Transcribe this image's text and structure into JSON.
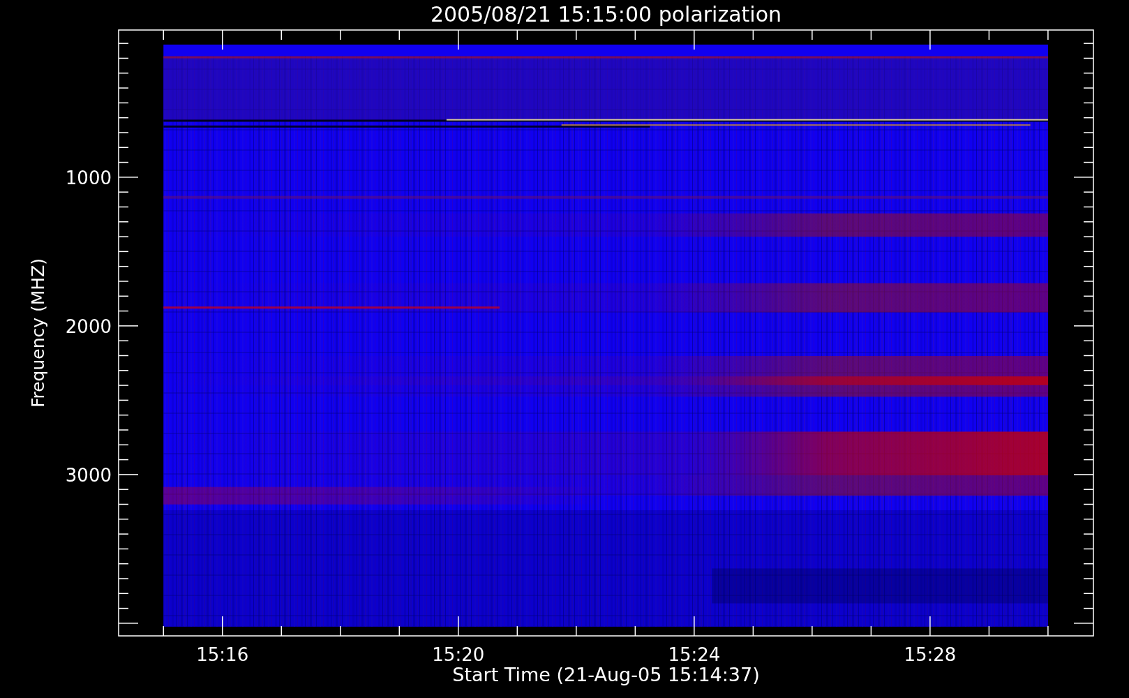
{
  "plot": {
    "title": "2005/08/21 15:15:00 polarization",
    "xlabel": "Start Time (21-Aug-05 15:14:37)",
    "ylabel": "Frequency (MHZ)",
    "xticks": [
      "15:16",
      "15:20",
      "15:24",
      "15:28"
    ],
    "yticks": [
      "1000",
      "2000",
      "3000"
    ]
  }
}
